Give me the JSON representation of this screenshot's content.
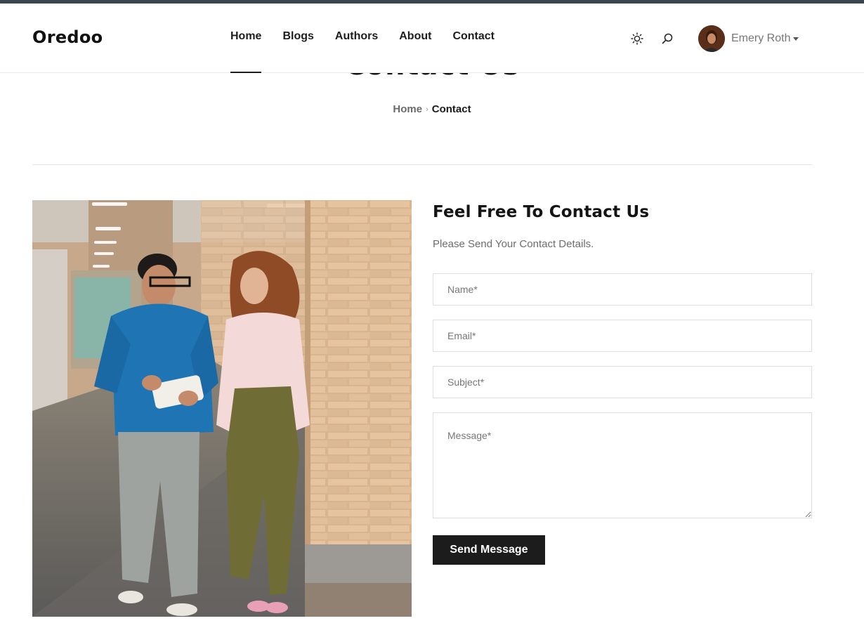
{
  "header": {
    "logo": "Oredoo",
    "nav": [
      "Home",
      "Blogs",
      "Authors",
      "About",
      "Contact"
    ],
    "active_nav": "Home",
    "icons": [
      "sun-icon",
      "search-icon"
    ],
    "user": {
      "name": "Emery Roth"
    }
  },
  "page": {
    "title": "Contact Us",
    "breadcrumb": [
      "Home",
      "Contact"
    ]
  },
  "contact": {
    "heading": "Feel Free To Contact Us",
    "subheading": "Please Send Your Contact Details.",
    "fields": {
      "name_placeholder": "Name*",
      "email_placeholder": "Email*",
      "subject_placeholder": "Subject*",
      "message_placeholder": "Message*"
    },
    "submit_label": "Send Message"
  },
  "colors": {
    "accent": "#1c1c1c",
    "topbar": "#3a454d"
  }
}
